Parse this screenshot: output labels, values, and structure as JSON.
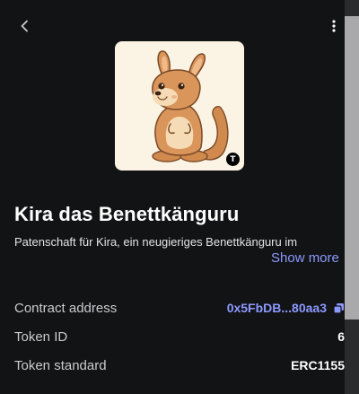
{
  "header": {
    "back_icon": "chevron-left-icon",
    "menu_icon": "vertical-dots-icon"
  },
  "nft": {
    "image_subject": "cartoon kangaroo",
    "network_badge": "T",
    "title": "Kira das Benettkänguru",
    "description": "Patenschaft für Kira, ein neugieriges Benettkänguru im",
    "show_more_label": "Show more"
  },
  "details": {
    "contract_label": "Contract address",
    "contract_value": "0x5FbDB...80aa3",
    "copy_icon": "copy-icon",
    "token_id_label": "Token ID",
    "token_id_value": "6",
    "standard_label": "Token standard",
    "standard_value": "ERC1155"
  },
  "colors": {
    "background": "#121314",
    "accent": "#8b99ff",
    "image_bg": "#fbf3e4"
  }
}
